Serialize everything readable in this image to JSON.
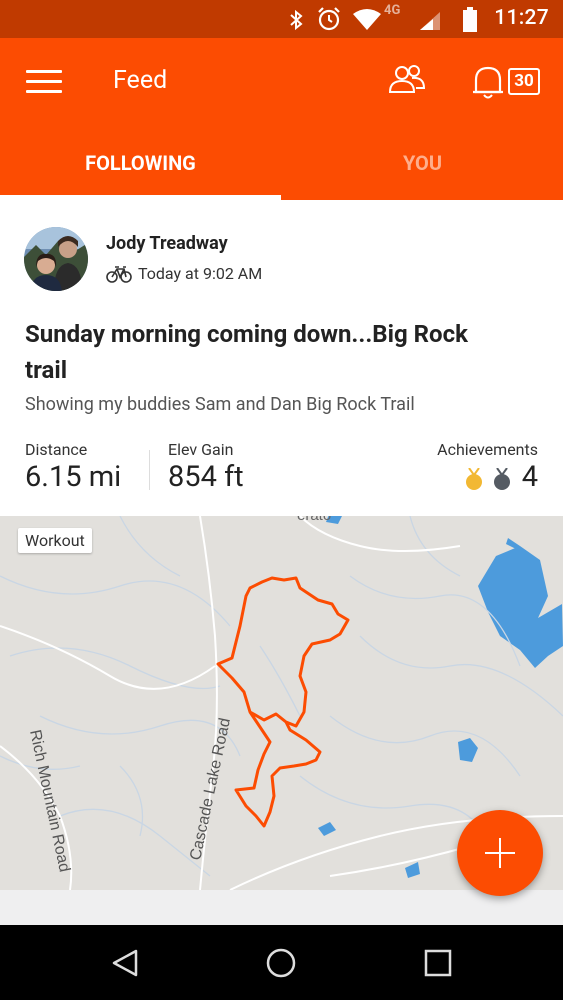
{
  "status_bar": {
    "time": "11:27",
    "network": "4G",
    "icons": [
      "bluetooth-icon",
      "alarm-icon",
      "wifi-icon",
      "signal-icon",
      "battery-icon"
    ]
  },
  "app_bar": {
    "title": "Feed",
    "notification_count": "30",
    "icons": [
      "menu-icon",
      "people-icon",
      "bell-icon"
    ]
  },
  "tabs": [
    {
      "label": "FOLLOWING",
      "active": true
    },
    {
      "label": "YOU",
      "active": false
    }
  ],
  "activity": {
    "athlete_name": "Jody Treadway",
    "activity_type_icon": "bike-icon",
    "timestamp": "Today at 9:02 AM",
    "title": "Sunday morning coming down...Big Rock trail",
    "description": "Showing my buddies Sam and Dan Big Rock Trail",
    "stats": {
      "distance_label": "Distance",
      "distance_value": "6.15 mi",
      "elev_label": "Elev Gain",
      "elev_value": "854 ft",
      "achievements_label": "Achievements",
      "achievements_value": "4"
    },
    "map": {
      "tag": "Workout",
      "road_labels": [
        "Cascade Lake Road",
        "Rich Mountain Road"
      ],
      "route_color": "#fc4c02"
    }
  },
  "colors": {
    "brand": "#fc4c02",
    "status_bar": "#c03a00",
    "gold_medal": "#f2b833",
    "silver_medal": "#555b63"
  }
}
